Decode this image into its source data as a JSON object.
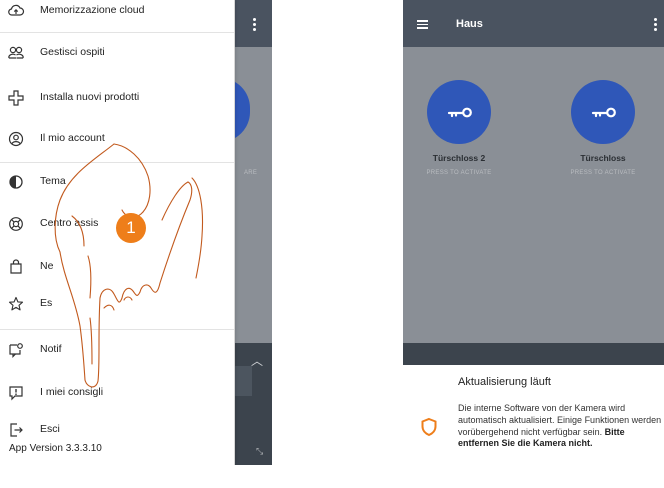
{
  "left_screen": {
    "menu": [
      {
        "label": "Memorizzazione cloud",
        "icon": "cloud-upload-icon"
      },
      {
        "label": "Gestisci ospiti",
        "icon": "guests-icon"
      },
      {
        "label": "Installa nuovi prodotti",
        "icon": "plus-icon"
      },
      {
        "label": "Il mio account",
        "icon": "account-icon"
      },
      {
        "label": "Tema",
        "icon": "theme-icon"
      },
      {
        "label": "Centro assis",
        "icon": "lifebuoy-icon"
      },
      {
        "label": "Ne",
        "icon": "shop-icon"
      },
      {
        "label": "Es",
        "icon": "star-icon"
      },
      {
        "label": "Notif",
        "icon": "notification-icon"
      },
      {
        "label": "I miei consigli",
        "icon": "tips-icon"
      },
      {
        "label": "Esci",
        "icon": "logout-icon"
      }
    ],
    "app_version": "App Version 3.3.3.10",
    "background_label": "ARE",
    "step_badge": "1"
  },
  "right_screen": {
    "title": "Haus",
    "locks": [
      {
        "name": "Türschloss 2",
        "action": "PRESS TO ACTIVATE"
      },
      {
        "name": "Türschloss",
        "action": "PRESS TO ACTIVATE"
      }
    ],
    "notice": {
      "title": "Aktualisierung läuft",
      "body": "Die interne Software von der Kamera wird automatisch aktualisiert. Einige Funktionen werden vorübergehend nicht verfügbar sein.",
      "body_bold": "Bitte entfernen Sie die Kamera nicht."
    }
  },
  "colors": {
    "accent_blue": "#2f57b8",
    "badge_orange": "#ee7e1a",
    "header_dark": "#4a5360",
    "overlay_gray": "#8a8f96"
  }
}
